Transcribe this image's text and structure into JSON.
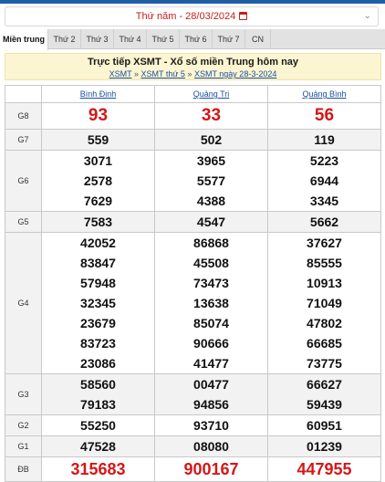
{
  "date_bar": {
    "text": "Thứ năm - 28/03/2024"
  },
  "tabs": [
    {
      "label": "Miền trung",
      "active": true
    },
    {
      "label": "Thứ 2"
    },
    {
      "label": "Thứ 3"
    },
    {
      "label": "Thứ 4"
    },
    {
      "label": "Thứ 5"
    },
    {
      "label": "Thứ 6"
    },
    {
      "label": "Thứ 7"
    },
    {
      "label": "CN"
    }
  ],
  "header": {
    "title": "Trực tiếp XSMT - Xổ số miền Trung hôm nay",
    "crumbs": [
      "XSMT",
      "XSMT thứ 5",
      "XSMT ngày 28-3-2024"
    ],
    "sep": "»"
  },
  "provinces": [
    "Bình Định",
    "Quảng Trị",
    "Quảng Bình"
  ],
  "prizes": [
    {
      "label": "G8",
      "values": [
        [
          "93"
        ],
        [
          "33"
        ],
        [
          "56"
        ]
      ]
    },
    {
      "label": "G7",
      "values": [
        [
          "559"
        ],
        [
          "502"
        ],
        [
          "119"
        ]
      ]
    },
    {
      "label": "G6",
      "values": [
        [
          "3071",
          "2578",
          "7629"
        ],
        [
          "3965",
          "5577",
          "4388"
        ],
        [
          "5223",
          "6944",
          "3345"
        ]
      ]
    },
    {
      "label": "G5",
      "values": [
        [
          "7583"
        ],
        [
          "4547"
        ],
        [
          "5662"
        ]
      ]
    },
    {
      "label": "G4",
      "values": [
        [
          "42052",
          "83847",
          "57948",
          "32345",
          "23679",
          "83723",
          "23086"
        ],
        [
          "86868",
          "45508",
          "73473",
          "13638",
          "85074",
          "90666",
          "41477"
        ],
        [
          "37627",
          "85555",
          "10913",
          "71049",
          "47802",
          "66685",
          "73775"
        ]
      ]
    },
    {
      "label": "G3",
      "values": [
        [
          "58560",
          "79183"
        ],
        [
          "00477",
          "94856"
        ],
        [
          "66627",
          "59439"
        ]
      ]
    },
    {
      "label": "G2",
      "values": [
        [
          "55250"
        ],
        [
          "93710"
        ],
        [
          "60951"
        ]
      ]
    },
    {
      "label": "G1",
      "values": [
        [
          "47528"
        ],
        [
          "08080"
        ],
        [
          "01239"
        ]
      ]
    },
    {
      "label": "ĐB",
      "values": [
        [
          "315683"
        ],
        [
          "900167"
        ],
        [
          "447955"
        ]
      ]
    }
  ]
}
